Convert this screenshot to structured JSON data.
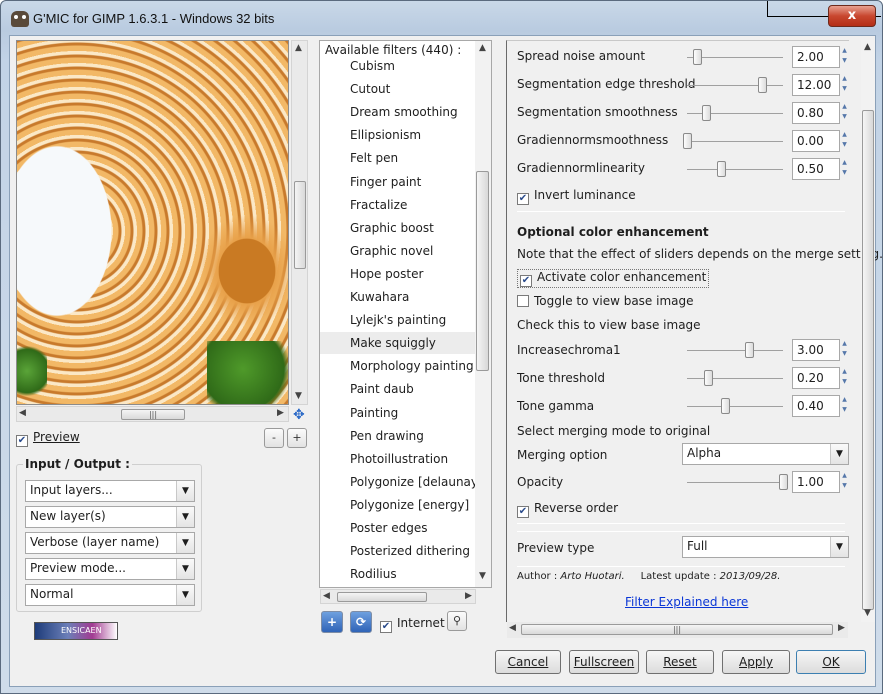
{
  "window": {
    "title": "G'MIC for GIMP 1.6.3.1 - Windows 32 bits",
    "close_label": "x"
  },
  "preview": {
    "checkbox_label": "Preview",
    "checked": true,
    "zoom_out": "-",
    "zoom_in": "+"
  },
  "io": {
    "title": "Input / Output :",
    "input_layers": "Input layers...",
    "output_mode": "New layer(s)",
    "verbosity": "Verbose (layer name)",
    "preview_mode": "Preview mode...",
    "blend_mode": "Normal"
  },
  "logo_text": "ENSICAEN",
  "filters": {
    "header": "Available filters (440) :",
    "items": [
      "Cubism",
      "Cutout",
      "Dream smoothing",
      "Ellipsionism",
      "Felt pen",
      "Finger paint",
      "Fractalize",
      "Graphic boost",
      "Graphic novel",
      "Hope poster",
      "Kuwahara",
      "Lylejk's painting",
      "Make squiggly",
      "Morphology painting",
      "Paint daub",
      "Painting",
      "Pen drawing",
      "Photoillustration",
      "Polygonize [delaunay]",
      "Polygonize [energy]",
      "Poster edges",
      "Posterized dithering",
      "Rodilius"
    ],
    "selected": "Make squiggly",
    "internet_label": "Internet"
  },
  "params": {
    "spread_noise": {
      "label": "Spread noise amount",
      "value": "2.00",
      "level": 0.1
    },
    "seg_edge": {
      "label": "Segmentation edge threshold",
      "value": "12.00",
      "level": 0.78
    },
    "seg_smooth": {
      "label": "Segmentation smoothness",
      "value": "0.80",
      "level": 0.2
    },
    "grad_smooth": {
      "label": "Gradiennormsmoothness",
      "value": "0.00",
      "level": 0.0
    },
    "grad_linear": {
      "label": "Gradiennormlinearity",
      "value": "0.50",
      "level": 0.35
    },
    "invert_luminance": {
      "label": "Invert luminance",
      "checked": true
    },
    "color_section_title": "Optional color enhancement",
    "color_note": "Note that the effect of sliders depends on the merge setting.",
    "activate_color": {
      "label": "Activate color enhancement",
      "checked": true
    },
    "toggle_base": {
      "label": "Toggle to view base image",
      "checked": false
    },
    "toggle_note": "Check this to view base image",
    "increase_chroma": {
      "label": "Increasechroma1",
      "value": "3.00",
      "level": 0.65
    },
    "tone_threshold": {
      "label": "Tone threshold",
      "value": "0.20",
      "level": 0.22
    },
    "tone_gamma": {
      "label": "Tone gamma",
      "value": "0.40",
      "level": 0.4
    },
    "merge_note": "Select merging mode to original",
    "merging_option": {
      "label": "Merging option",
      "value": "Alpha"
    },
    "opacity": {
      "label": "Opacity",
      "value": "1.00",
      "level": 1.0
    },
    "reverse_order": {
      "label": "Reverse order",
      "checked": true
    },
    "preview_type": {
      "label": "Preview type",
      "value": "Full"
    },
    "author_label": "Author :",
    "author_name": "Arto Huotari.",
    "update_label": "Latest update :",
    "update_date": "2013/09/28.",
    "link": "Filter Explained here"
  },
  "buttons": {
    "cancel": "Cancel",
    "fullscreen": "Fullscreen",
    "reset": "Reset",
    "apply": "Apply",
    "ok": "OK"
  },
  "colors": {
    "link": "#0a36d6",
    "close": "#c8472f",
    "accent": "#2f63b7"
  }
}
